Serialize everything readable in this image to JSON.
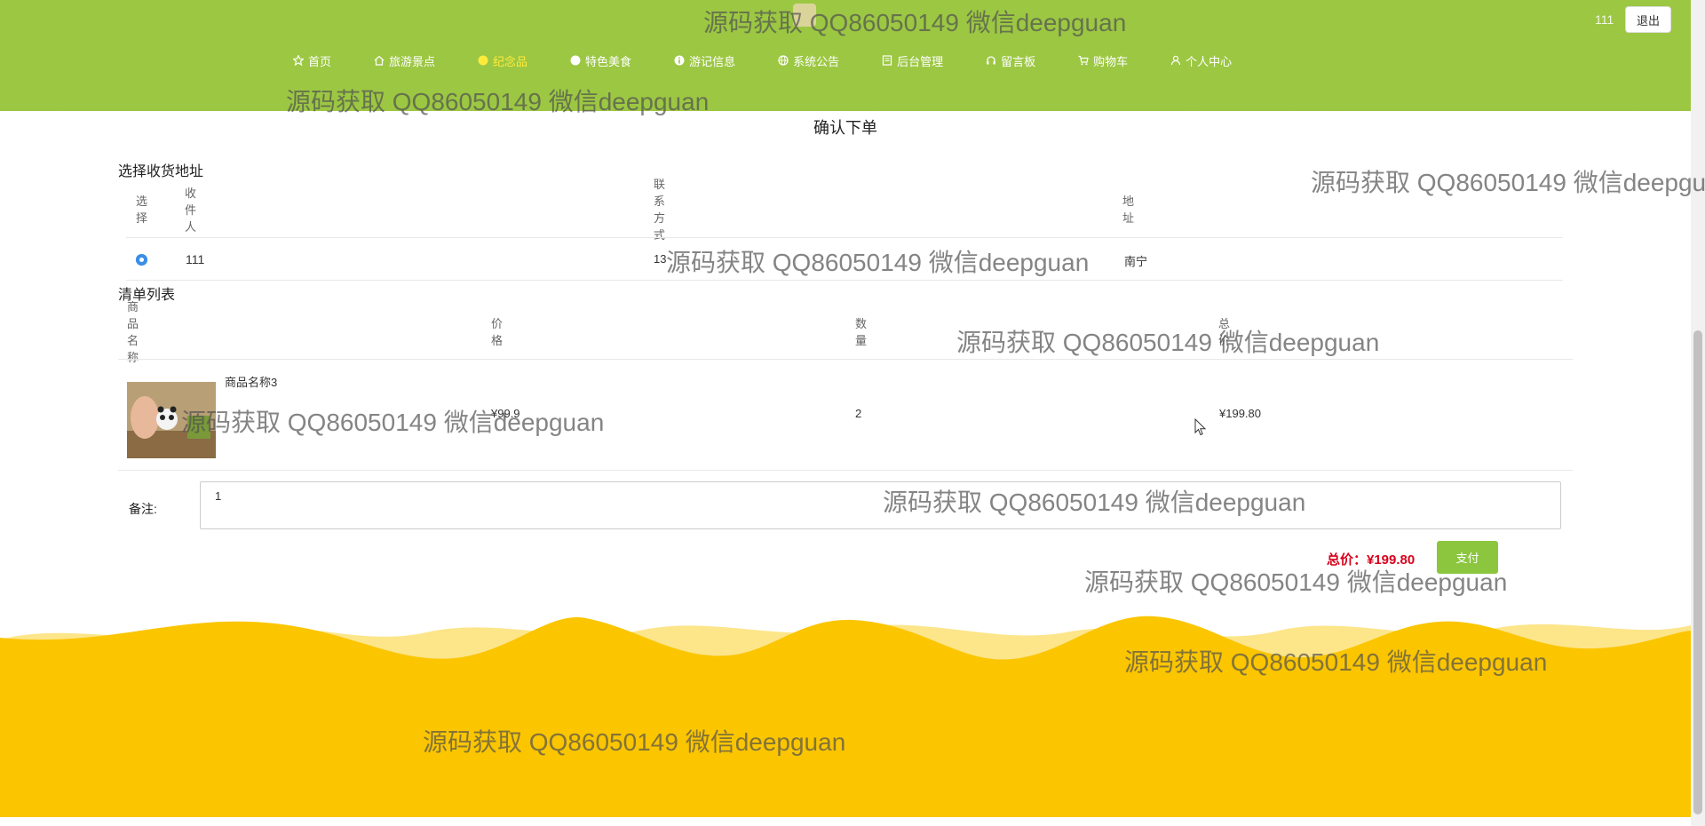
{
  "header": {
    "site_title": "",
    "user_name": "111",
    "logout_label": "退出",
    "nav": [
      {
        "label": "首页",
        "icon": "star-icon"
      },
      {
        "label": "旅游景点",
        "icon": "home-icon"
      },
      {
        "label": "纪念品",
        "icon": "circle-icon",
        "active": true
      },
      {
        "label": "特色美食",
        "icon": "circle-icon"
      },
      {
        "label": "游记信息",
        "icon": "info-icon"
      },
      {
        "label": "系统公告",
        "icon": "globe-icon"
      },
      {
        "label": "后台管理",
        "icon": "doc-icon"
      },
      {
        "label": "留言板",
        "icon": "headset-icon"
      },
      {
        "label": "购物车",
        "icon": "cart-icon"
      },
      {
        "label": "个人中心",
        "icon": "user-icon"
      }
    ]
  },
  "page_heading": "确认下单",
  "address": {
    "section_title": "选择收货地址",
    "columns": [
      "选择",
      "收件人",
      "联系方式",
      "地址"
    ],
    "rows": [
      {
        "selected": true,
        "receiver": "111",
        "phone": "13",
        "address": "南宁"
      }
    ]
  },
  "order_list": {
    "section_title": "清单列表",
    "columns": [
      "商品名称",
      "价格",
      "数量",
      "总价"
    ],
    "items": [
      {
        "name": "商品名称3",
        "price": "¥99.9",
        "quantity": "2",
        "total": "¥199.80"
      }
    ]
  },
  "remark": {
    "label": "备注:",
    "value": "1"
  },
  "summary": {
    "total_label": "总价：¥199.80",
    "pay_label": "支付"
  },
  "watermark_text": "源码获取 QQ86050149 微信deepguan",
  "colors": {
    "header_green": "#9cc743",
    "footer_yellow": "#fbc500",
    "accent_red": "#d9001b",
    "pay_green": "#8cc63f"
  }
}
